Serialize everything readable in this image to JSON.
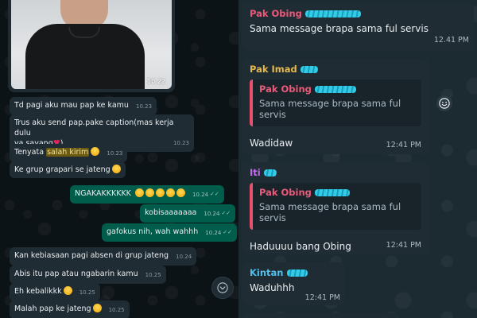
{
  "left_chat": {
    "photo": {
      "time": "10.22"
    },
    "messages": [
      {
        "id": "m1",
        "dir": "in",
        "text": "Td pagi aku mau pap ke kamu",
        "time": "10.23"
      },
      {
        "id": "m2",
        "dir": "in",
        "line1": "Trus aku send pap.pake caption(mas kerja dulu",
        "line2": "ya sayang",
        "line2_tail": ")",
        "time": "10.23"
      },
      {
        "id": "m3",
        "dir": "in",
        "pre": "Tenyata ",
        "highlight": "salah kirim",
        "time": "10.23"
      },
      {
        "id": "m4",
        "dir": "in",
        "text": "Ke grup grapari se jateng",
        "time": "10.23"
      },
      {
        "id": "m5",
        "dir": "out",
        "text": "NGAKAKKKKKK",
        "time": "10.24"
      },
      {
        "id": "m6",
        "dir": "out",
        "text": "kobisaaaaaaa",
        "time": "10.24"
      },
      {
        "id": "m7",
        "dir": "out",
        "text": "gafokus nih, wah wahhh",
        "time": "10.24"
      },
      {
        "id": "m8",
        "dir": "in",
        "text": "Kan kebiasaan pagi absen di grup jateng",
        "time": "10.24"
      },
      {
        "id": "m9",
        "dir": "in",
        "text": "Abis itu pap atau ngabarin kamu",
        "time": "10.25"
      },
      {
        "id": "m10",
        "dir": "in",
        "text": "Eh kebalikkk",
        "time": "10.25"
      },
      {
        "id": "m11",
        "dir": "in",
        "text": "Malah pap ke jateng",
        "time": "10.25"
      }
    ],
    "scroll_icon": "chevron-down-icon"
  },
  "right_chat": {
    "messages": [
      {
        "sender": "Pak Obing",
        "sender_color": "#ea5a7a",
        "text": "Sama message brapa sama ful servis",
        "time": "12.41 PM"
      },
      {
        "sender": "Pak Imad",
        "sender_color": "#e5b94e",
        "quote": {
          "name": "Pak Obing",
          "text": "Sama message brapa sama ful servis"
        },
        "text": "Wadidaw",
        "time": "12:41 PM"
      },
      {
        "sender": "Iti",
        "sender_color": "#c56cf0",
        "quote": {
          "name": "Pak Obing",
          "text": "Sama message brapa sama ful servis"
        },
        "text": "Haduuuu bang Obing",
        "time": "12:41 PM"
      },
      {
        "sender": "Kintan",
        "sender_color": "#53bdeb",
        "text": "Waduhhh",
        "time": "12:41 PM"
      }
    ],
    "react_icon": "smiley-icon"
  },
  "colors": {
    "incoming_bubble": "#202c33",
    "outgoing_bubble": "#005c4b",
    "redaction": "#34d4f0"
  }
}
